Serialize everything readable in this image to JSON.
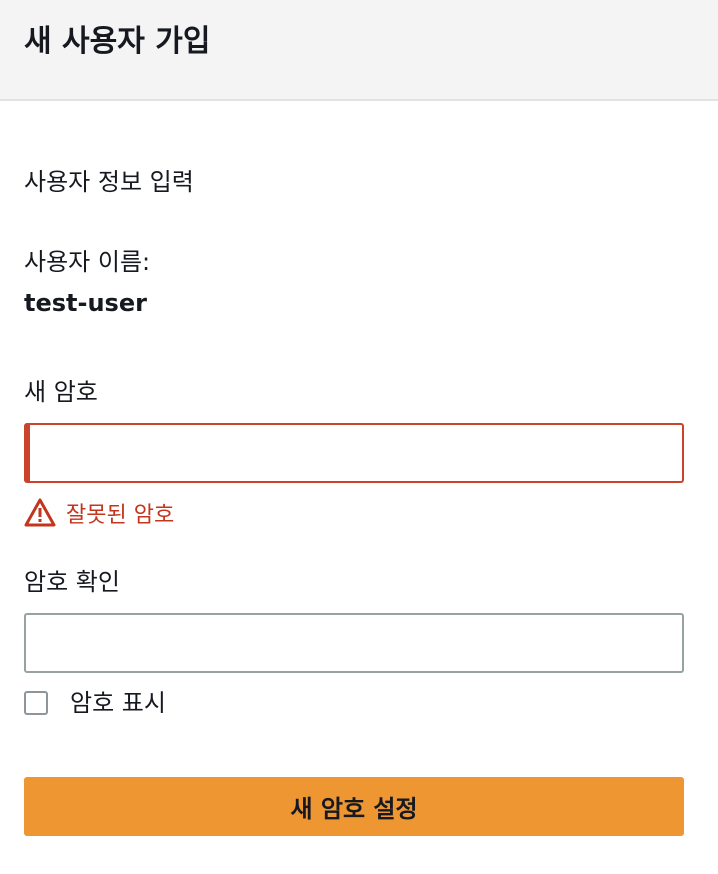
{
  "header": {
    "title": "새 사용자 가입"
  },
  "form": {
    "section_title": "사용자 정보 입력",
    "username_label": "사용자 이름:",
    "username_value": "test-user",
    "new_password": {
      "label": "새 암호",
      "value": "",
      "error": "잘못된 암호"
    },
    "confirm_password": {
      "label": "암호 확인",
      "value": ""
    },
    "show_password": {
      "label": "암호 표시",
      "checked": false
    },
    "submit_label": "새 암호 설정"
  },
  "colors": {
    "header_bg": "#f4f4f4",
    "error": "#c3361e",
    "button_bg": "#ee9632",
    "input_border": "#97a3a3"
  },
  "icons": {
    "error": "warning-triangle-icon"
  }
}
